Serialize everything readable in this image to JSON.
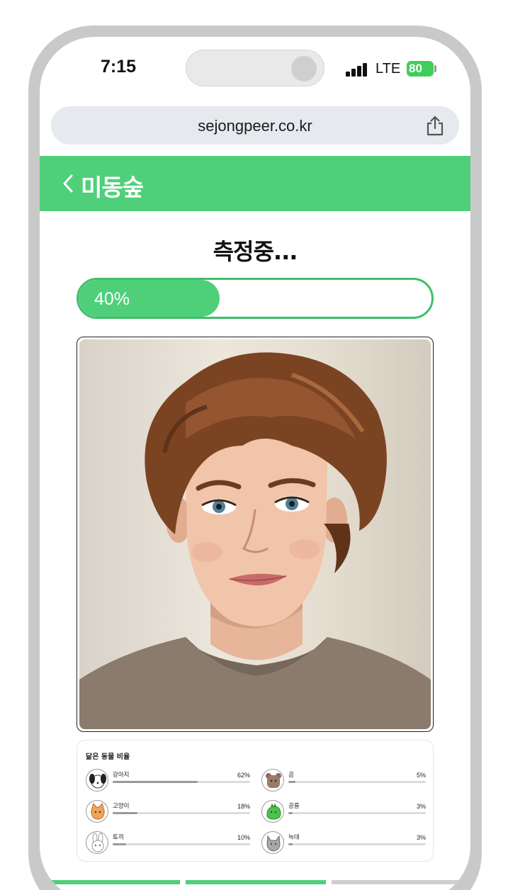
{
  "status": {
    "time": "7:15",
    "network": "LTE",
    "battery": "80"
  },
  "browser": {
    "url": "sejongpeer.co.kr"
  },
  "header": {
    "title": "미동숲"
  },
  "measure": {
    "title": "측정중...",
    "progress": 0.4,
    "progress_label": "40%"
  },
  "results": {
    "title": "닮은 동물 비율",
    "animals": [
      {
        "name": "강아지",
        "percent_label": "62%",
        "value": 0.62
      },
      {
        "name": "곰",
        "percent_label": "5%",
        "value": 0.05
      },
      {
        "name": "고양이",
        "percent_label": "18%",
        "value": 0.18
      },
      {
        "name": "공룡",
        "percent_label": "3%",
        "value": 0.03
      },
      {
        "name": "토끼",
        "percent_label": "10%",
        "value": 0.1
      },
      {
        "name": "늑대",
        "percent_label": "3%",
        "value": 0.03
      }
    ]
  },
  "colors": {
    "brand_green": "#50cf7a",
    "track_border": "#3fbf6a"
  }
}
